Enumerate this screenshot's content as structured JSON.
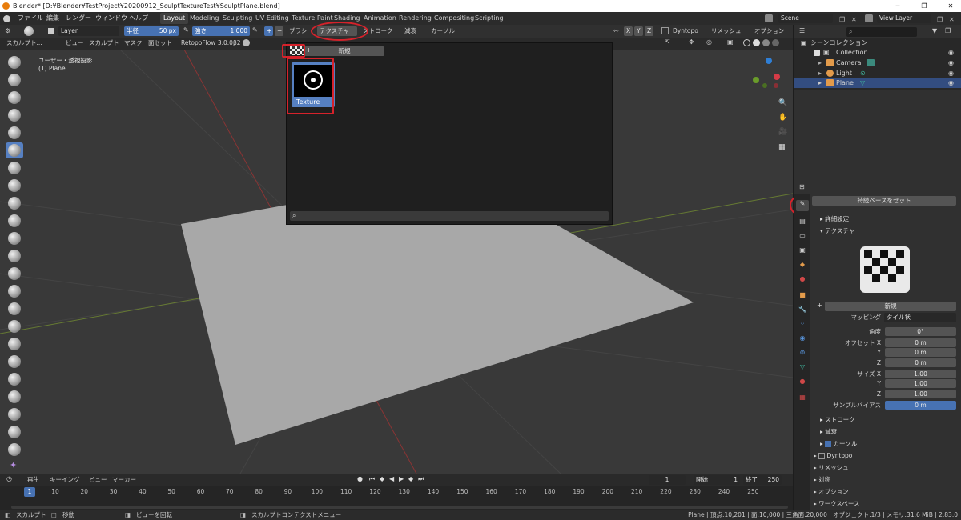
{
  "window": {
    "title": "Blender* [D:¥Blender¥TestProject¥20200912_SculptTextureTest¥SculptPlane.blend]"
  },
  "menu": {
    "items": [
      "ファイル",
      "編集",
      "レンダー",
      "ウィンドウ",
      "ヘルプ"
    ]
  },
  "workspaces": [
    "Layout",
    "Modeling",
    "Sculpting",
    "UV Editing",
    "Texture Paint",
    "Shading",
    "Animation",
    "Rendering",
    "Compositing",
    "Scripting"
  ],
  "scene": {
    "label": "Scene",
    "view_layer": "View Layer"
  },
  "header": {
    "layer": "Layer",
    "radius_label": "半径",
    "radius_value": "50 px",
    "strength_label": "強さ",
    "strength_value": "1.000",
    "menus": [
      "ブラシ",
      "テクスチャ",
      "ストローク",
      "減衰",
      "カーソル"
    ],
    "xyz": [
      "X",
      "Y",
      "Z"
    ],
    "dyntopo": "Dyntopo",
    "remesh": "リメッシュ",
    "options": "オプション"
  },
  "header2": {
    "mode": "スカルプト...",
    "items": [
      "ビュー",
      "スカルプト",
      "マスク",
      "面セット"
    ],
    "addon": "RetopoFlow 3.0.0β2"
  },
  "viewport": {
    "view_name": "ユーザー・透視投影",
    "object": "(1) Plane"
  },
  "popup": {
    "new_label": "新規",
    "texture_name": "Texture",
    "search_placeholder": ""
  },
  "outliner": {
    "title": "シーンコレクション",
    "rows": [
      {
        "name": "Collection"
      },
      {
        "name": "Camera"
      },
      {
        "name": "Light"
      },
      {
        "name": "Plane"
      }
    ]
  },
  "properties": {
    "set_base": "持続ベースをセット",
    "advanced": "詳細設定",
    "texture_section": "テクスチャ",
    "new_btn": "新規",
    "mapping_label": "マッピング",
    "mapping_value": "タイル状",
    "angle_label": "角度",
    "angle_value": "0°",
    "offset_x_label": "オフセット X",
    "offset_y_label": "Y",
    "offset_z_label": "Z",
    "offset_x": "0 m",
    "offset_y": "0 m",
    "offset_z": "0 m",
    "size_x_label": "サイズ X",
    "size_y_label": "Y",
    "size_z_label": "Z",
    "size_x": "1.00",
    "size_y": "1.00",
    "size_z": "1.00",
    "sample_bias_label": "サンプルバイアス",
    "sample_bias_value": "0 m",
    "sections": [
      "ストローク",
      "減衰",
      "カーソル",
      "Dyntopo",
      "リメッシュ",
      "対称",
      "オプション",
      "ワークスペース"
    ]
  },
  "timeline": {
    "menus": [
      "再生",
      "キーイング",
      "ビュー",
      "マーカー"
    ],
    "current_frame": "1",
    "start_label": "開始",
    "start": "1",
    "end_label": "終了",
    "end": "250",
    "ticks": [
      "1",
      "10",
      "20",
      "30",
      "40",
      "50",
      "60",
      "70",
      "80",
      "90",
      "100",
      "110",
      "120",
      "130",
      "140",
      "150",
      "160",
      "170",
      "180",
      "190",
      "200",
      "210",
      "220",
      "230",
      "240",
      "250"
    ]
  },
  "status": {
    "left": "スカルプト",
    "move": "移動",
    "rotate": "ビューを回転",
    "context": "スカルプトコンテクストメニュー",
    "stats": "Plane | 頂点:10,201 | 面:10,000 | 三角面:20,000 | オブジェクト:1/3 | メモリ:31.6 MiB | 2.83.0"
  },
  "colors": {
    "accent": "#4772b3",
    "highlight_red": "#d6222b",
    "plane": "#a8a8a8"
  }
}
